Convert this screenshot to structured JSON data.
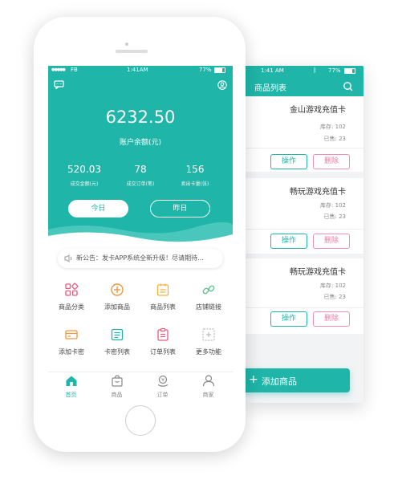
{
  "back": {
    "status": {
      "time": "1:41 AM",
      "battery": "77%"
    },
    "header": {
      "title": "商品列表"
    },
    "products": [
      {
        "name": "金山游戏充值卡",
        "stock": "库存: 102",
        "sold": "已售: 23",
        "op": "操作",
        "del": "删除"
      },
      {
        "name": "畅玩游戏充值卡",
        "stock": "库存: 102",
        "sold": "已售: 23",
        "op": "操作",
        "del": "删除"
      },
      {
        "name": "畅玩游戏充值卡",
        "stock": "库存: 102",
        "sold": "已售: 23",
        "op": "操作",
        "del": "删除"
      }
    ],
    "add_button": "添加商品"
  },
  "front": {
    "status": {
      "carrier": "FB",
      "time": "1:41AM",
      "battery": "77%"
    },
    "balance": {
      "amount": "6232.50",
      "label": "账户余额(元)"
    },
    "stats": [
      {
        "value": "520.03",
        "label": "成交金额(元)"
      },
      {
        "value": "78",
        "label": "成交订单(笔)"
      },
      {
        "value": "156",
        "label": "卖出卡量(张)"
      }
    ],
    "toggle": {
      "today": "今日",
      "yesterday": "昨日"
    },
    "notice": "新公告：发卡APP系统全新升级！尽请期待...",
    "grid": [
      {
        "label": "商品分类",
        "icon": "category-icon",
        "color": "#f0597a"
      },
      {
        "label": "添加商品",
        "icon": "add-circle-icon",
        "color": "#f3963a"
      },
      {
        "label": "商品列表",
        "icon": "calendar-list-icon",
        "color": "#f3b23a"
      },
      {
        "label": "店铺链接",
        "icon": "link-icon",
        "color": "#5cc48a"
      },
      {
        "label": "添加卡密",
        "icon": "card-icon",
        "color": "#f3963a"
      },
      {
        "label": "卡密列表",
        "icon": "card-list-icon",
        "color": "#1fb5a8"
      },
      {
        "label": "订单列表",
        "icon": "order-list-icon",
        "color": "#f0597a"
      },
      {
        "label": "更多功能",
        "icon": "more-icon",
        "color": "#bbbbbb"
      }
    ],
    "tabs": [
      {
        "label": "首页",
        "icon": "home-icon"
      },
      {
        "label": "商品",
        "icon": "bag-icon"
      },
      {
        "label": "订单",
        "icon": "order-icon"
      },
      {
        "label": "商家",
        "icon": "merchant-icon"
      }
    ],
    "colors": {
      "primary": "#1fb5a8",
      "accent_pink": "#f07aa3"
    }
  }
}
